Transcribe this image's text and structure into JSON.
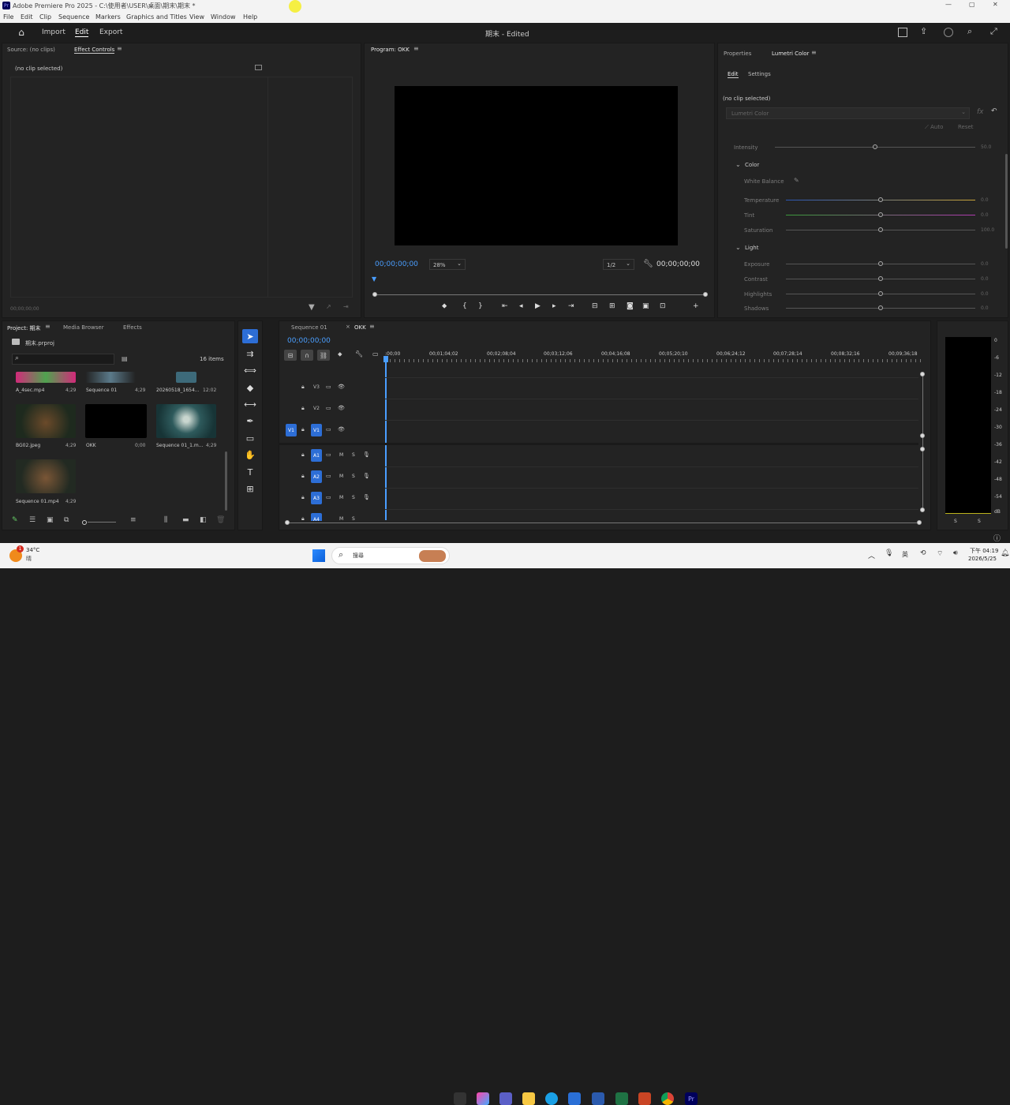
{
  "app": {
    "title": "Adobe Premiere Pro 2025 - C:\\使用者\\USER\\桌面\\期末\\期末 *",
    "project_status": "期末 - Edited"
  },
  "menu": [
    "File",
    "Edit",
    "Clip",
    "Sequence",
    "Markers",
    "Graphics and Titles",
    "View",
    "Window",
    "Help"
  ],
  "topnav": {
    "import": "Import",
    "edit": "Edit",
    "export": "Export"
  },
  "source_panel": {
    "tab_source": "Source: (no clips)",
    "tab_effect_controls": "Effect Controls",
    "no_clip": "(no clip selected)",
    "timecode": "00;00;00;00"
  },
  "program_panel": {
    "tab": "Program: OKK",
    "timecode_left": "00;00;00;00",
    "zoom": "28%",
    "resolution": "1/2",
    "timecode_right": "00;00;00;00"
  },
  "lumetri": {
    "tab_properties": "Properties",
    "tab_lumetri": "Lumetri Color",
    "sub_edit": "Edit",
    "sub_settings": "Settings",
    "no_clip": "(no clip selected)",
    "effect_select": "Lumetri Color",
    "auto": "Auto",
    "reset": "Reset",
    "intensity": {
      "label": "Intensity",
      "value": "50.0",
      "level": 0.5
    },
    "color_section": "Color",
    "white_balance": "White Balance",
    "temperature": {
      "label": "Temperature",
      "value": "0.0",
      "level": 0.5
    },
    "tint": {
      "label": "Tint",
      "value": "0.0",
      "level": 0.5
    },
    "saturation": {
      "label": "Saturation",
      "value": "100.0",
      "level": 0.5
    },
    "light_section": "Light",
    "exposure": {
      "label": "Exposure",
      "value": "0.0",
      "level": 0.5
    },
    "contrast": {
      "label": "Contrast",
      "value": "0.0",
      "level": 0.5
    },
    "highlights": {
      "label": "Highlights",
      "value": "0.0",
      "level": 0.5
    },
    "shadows": {
      "label": "Shadows",
      "value": "0.0",
      "level": 0.5
    }
  },
  "project_panel": {
    "tab_project": "Project: 期末",
    "tab_media": "Media Browser",
    "tab_effects": "Effects",
    "file": "期末.prproj",
    "items": "16 items",
    "files": [
      {
        "name": "A_4sec.mp4",
        "dur": "4;29"
      },
      {
        "name": "Sequence 01",
        "dur": "4;29"
      },
      {
        "name": "20260518_1654...",
        "dur": "12:02"
      },
      {
        "name": "BG02.jpeg",
        "dur": "4;29"
      },
      {
        "name": "OKK",
        "dur": "0;00"
      },
      {
        "name": "Sequence 01_1.m...",
        "dur": "4;29"
      },
      {
        "name": "Sequence 01.mp4",
        "dur": "4;29"
      }
    ]
  },
  "timeline": {
    "tab_seq": "Sequence 01",
    "tab_okk": "OKK",
    "timecode": "00;00;00;00",
    "ruler": [
      ":00;00",
      "00;01;04;02",
      "00;02;08;04",
      "00;03;12;06",
      "00;04;16;08",
      "00;05;20;10",
      "00;06;24;12",
      "00;07;28;14",
      "00;08;32;16",
      "00;09;36;18"
    ],
    "video_tracks": [
      "V3",
      "V2",
      "V1"
    ],
    "audio_tracks": [
      "A1",
      "A2",
      "A3",
      "A4"
    ],
    "v1_source": "V1",
    "m": "M",
    "s": "S"
  },
  "meter": {
    "scale": [
      "0",
      "-6",
      "-12",
      "-18",
      "-24",
      "-30",
      "-36",
      "-42",
      "-48",
      "-54",
      "dB"
    ],
    "s_left": "S",
    "s_right": "S"
  },
  "taskbar": {
    "weather_temp": "34°C",
    "weather_desc": "晴",
    "search": "搜尋",
    "ime": "英",
    "time": "下午 04:19",
    "date": "2026/5/25",
    "badge": "1"
  }
}
